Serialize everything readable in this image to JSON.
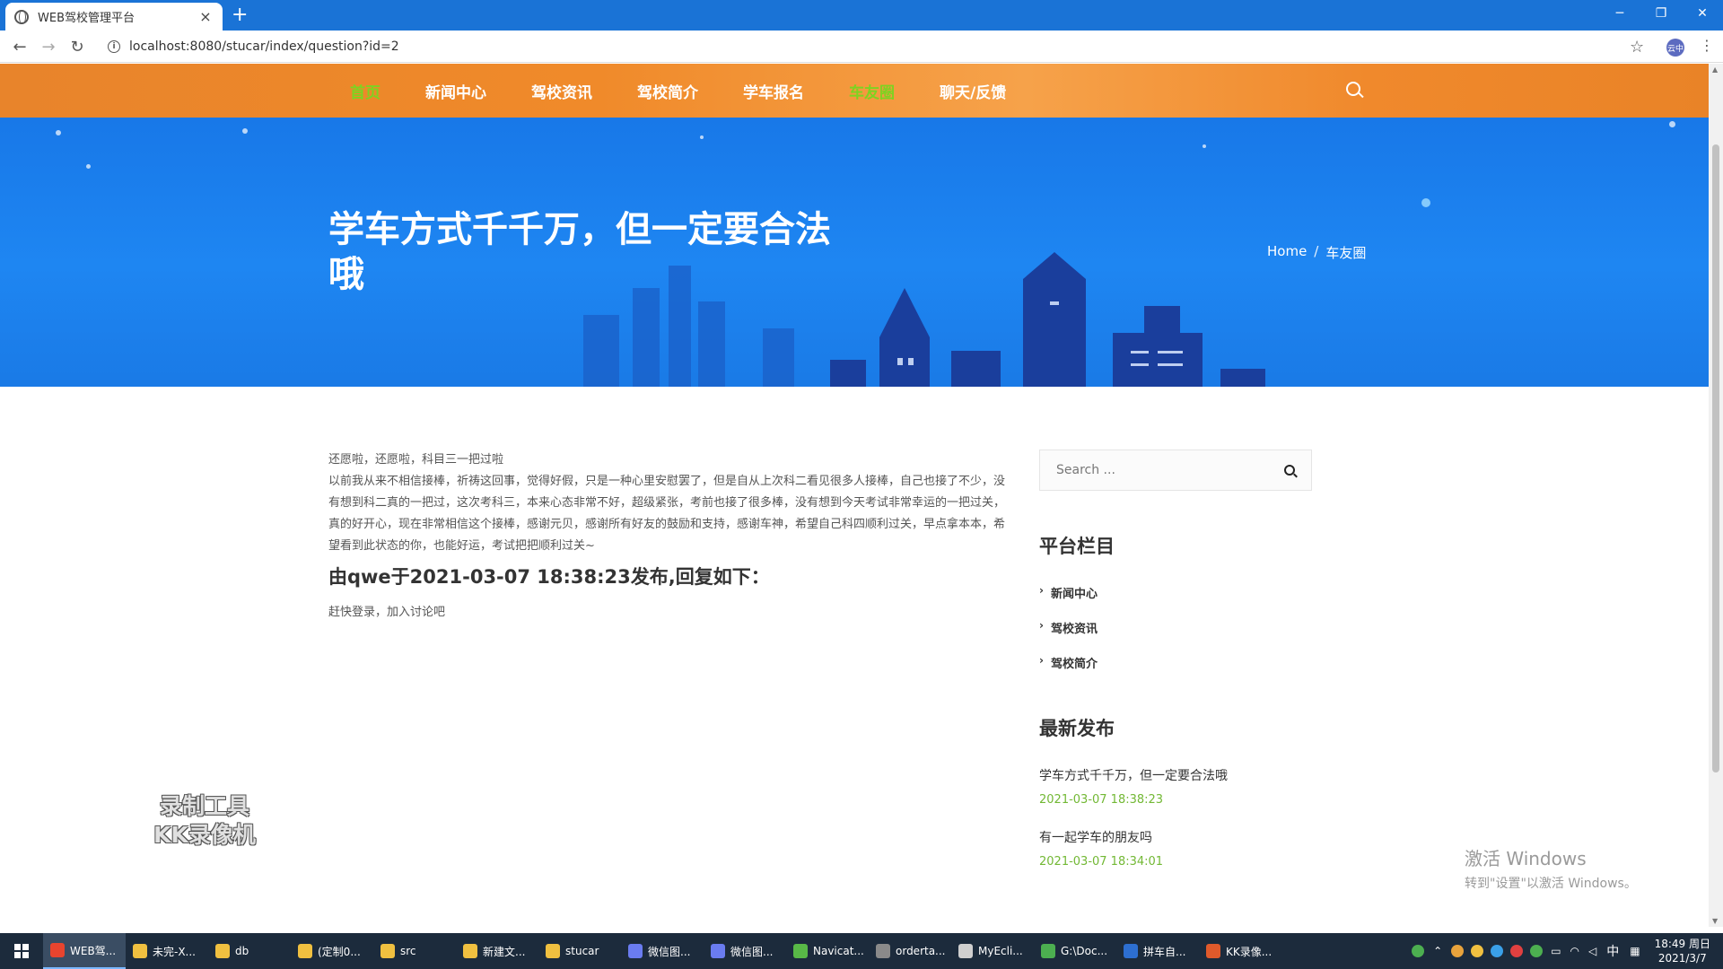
{
  "browser": {
    "tab_title": "WEB驾校管理平台",
    "tab_close": "×",
    "new_tab": "+",
    "url": "localhost:8080/stucar/index/question?id=2",
    "back": "←",
    "forward": "→",
    "reload": "↻",
    "star": "☆",
    "profile": "云中",
    "menu": "⋮",
    "minimize": "─",
    "restore": "❐",
    "close": "✕"
  },
  "nav": {
    "items": [
      {
        "label": "首页",
        "state": "active"
      },
      {
        "label": "新闻中心",
        "state": ""
      },
      {
        "label": "驾校资讯",
        "state": ""
      },
      {
        "label": "驾校简介",
        "state": ""
      },
      {
        "label": "学车报名",
        "state": ""
      },
      {
        "label": "车友圈",
        "state": "hover"
      },
      {
        "label": "聊天/反馈",
        "state": ""
      }
    ]
  },
  "hero": {
    "title": "学车方式千千万，但一定要合法哦",
    "breadcrumb_home": "Home",
    "breadcrumb_sep": "/",
    "breadcrumb_current": "车友圈"
  },
  "post": {
    "line1": "还愿啦，还愿啦，科目三一把过啦",
    "body": "以前我从来不相信接棒，祈祷这回事，觉得好假，只是一种心里安慰罢了，但是自从上次科二看见很多人接棒，自己也接了不少，没有想到科二真的一把过，这次考科三，本来心态非常不好，超级紧张，考前也接了很多棒，没有想到今天考试非常幸运的一把过关，真的好开心，现在非常相信这个接棒，感谢元贝，感谢所有好友的鼓励和支持，感谢车神，希望自己科四顺利过关，早点拿本本，希望看到此状态的你，也能好运，考试把把顺利过关~",
    "reply_heading": "由qwe于2021-03-07 18:38:23发布,回复如下：",
    "login_tip": "赶快登录，加入讨论吧"
  },
  "sidebar": {
    "search_placeholder": "Search ...",
    "categories_title": "平台栏目",
    "categories": [
      "新闻中心",
      "驾校资讯",
      "驾校简介"
    ],
    "latest_title": "最新发布",
    "latest": [
      {
        "title": "学车方式千千万，但一定要合法哦",
        "date": "2021-03-07 18:38:23"
      },
      {
        "title": "有一起学车的朋友吗",
        "date": "2021-03-07 18:34:01"
      }
    ]
  },
  "watermarks": {
    "recorder_line1": "录制工具",
    "recorder_line2": "KK录像机",
    "activate_line1": "激活 Windows",
    "activate_line2": "转到\"设置\"以激活 Windows。"
  },
  "taskbar": {
    "items": [
      {
        "label": "WEB驾...",
        "color": "#e8442e",
        "active": true
      },
      {
        "label": "未完-X...",
        "color": "#f0c040",
        "active": false
      },
      {
        "label": "db",
        "color": "#f0c040",
        "active": false
      },
      {
        "label": "(定制0...",
        "color": "#f0c040",
        "active": false
      },
      {
        "label": "src",
        "color": "#f0c040",
        "active": false
      },
      {
        "label": "新建文...",
        "color": "#f0c040",
        "active": false
      },
      {
        "label": "stucar",
        "color": "#f0c040",
        "active": false
      },
      {
        "label": "微信图...",
        "color": "#6a7cf0",
        "active": false
      },
      {
        "label": "微信图...",
        "color": "#6a7cf0",
        "active": false
      },
      {
        "label": "Navicat...",
        "color": "#58b947",
        "active": false
      },
      {
        "label": "orderta...",
        "color": "#8a8a8a",
        "active": false
      },
      {
        "label": "MyEcli...",
        "color": "#cfcfcf",
        "active": false
      },
      {
        "label": "G:\\Doc...",
        "color": "#4caf50",
        "active": false
      },
      {
        "label": "拼车自...",
        "color": "#2d6fd1",
        "active": false
      },
      {
        "label": "KK录像...",
        "color": "#e05a2b",
        "active": false
      }
    ],
    "tray_ime": "中",
    "time": "18:49 周日",
    "date": "2021/3/7"
  },
  "colors": {
    "nav_orange": "#f08a2a",
    "hero_blue": "#1e86f2",
    "accent_green": "#72b834",
    "taskbar": "#1c2b3c"
  }
}
